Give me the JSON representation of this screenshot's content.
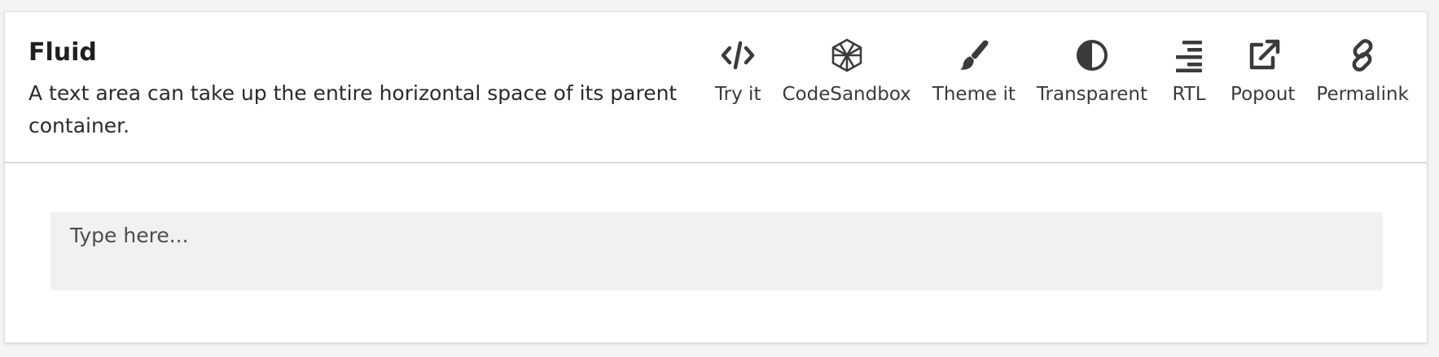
{
  "header": {
    "title": "Fluid",
    "description": "A text area can take up the entire horizontal space of its parent container."
  },
  "toolbar": {
    "items": [
      {
        "label": "Try it",
        "icon": "code-icon"
      },
      {
        "label": "CodeSandbox",
        "icon": "codesandbox-icon"
      },
      {
        "label": "Theme it",
        "icon": "paintbrush-icon"
      },
      {
        "label": "Transparent",
        "icon": "half-circle-icon"
      },
      {
        "label": "RTL",
        "icon": "align-right-icon"
      },
      {
        "label": "Popout",
        "icon": "external-link-icon"
      },
      {
        "label": "Permalink",
        "icon": "link-icon"
      }
    ]
  },
  "example": {
    "textarea_placeholder": "Type here..."
  },
  "colors": {
    "card_background": "#ffffff",
    "page_background": "#f4f4f4",
    "textarea_background": "#f2f1f0",
    "icon": "#3b3b3b"
  }
}
